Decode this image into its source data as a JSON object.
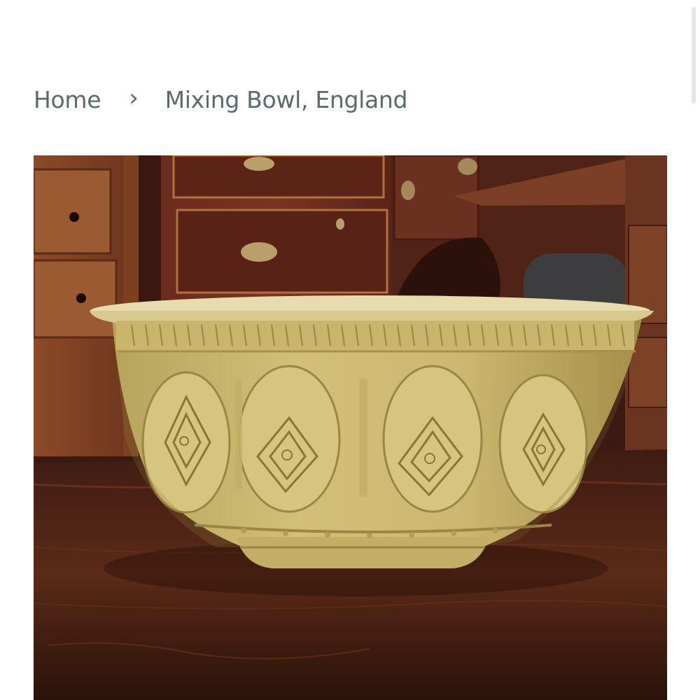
{
  "breadcrumb": {
    "home_label": "Home",
    "separator": "›",
    "current_label": "Mixing Bowl, England"
  },
  "product_image": {
    "subject": "glazed stoneware mixing bowl on wooden table",
    "colors": {
      "glaze": "#c9b56c",
      "wood_dark": "#3b1a12",
      "wood_mid": "#6b341f"
    }
  },
  "icons": {
    "separator_icon": "chevron-right-icon"
  }
}
